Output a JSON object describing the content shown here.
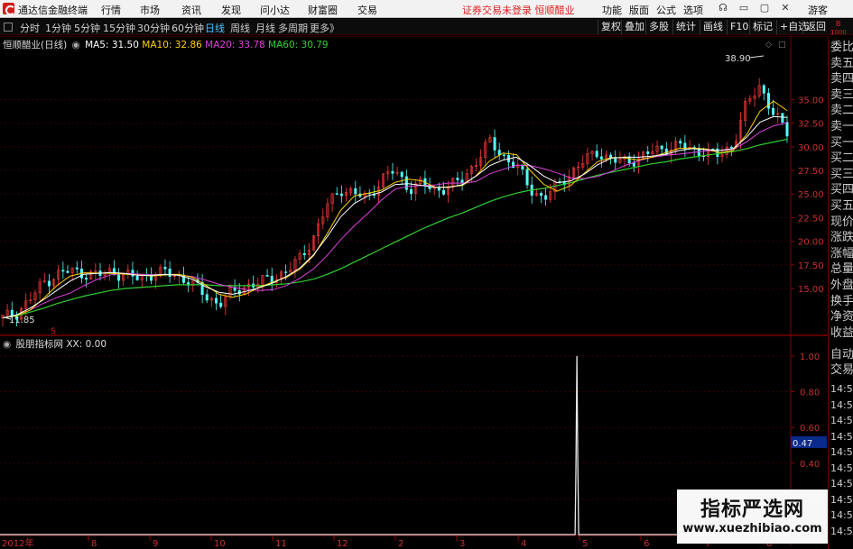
{
  "window": {
    "title": "通达信金融终端",
    "menus": [
      "行情",
      "市场",
      "资讯",
      "发现",
      "问小达",
      "财富圈",
      "交易"
    ],
    "notice": "证券交易未登录  恒顺醋业",
    "right_menus": [
      "功能",
      "版面",
      "公式",
      "选项"
    ],
    "user": "游客"
  },
  "toolbar": {
    "periods": [
      "分时",
      "1分钟",
      "5分钟",
      "15分钟",
      "30分钟",
      "60分钟",
      "日线",
      "周线",
      "月线",
      "多周期",
      "更多》"
    ],
    "active_period": "日线",
    "right_buttons": [
      "复权",
      "叠加",
      "多股",
      "统计",
      "画线",
      "F10",
      "标记",
      "+自选",
      "返回"
    ]
  },
  "stock": {
    "name_line": "恒顺醋业(日线)",
    "ma": [
      {
        "label": "MA5: 31.50",
        "color": "#ffffff"
      },
      {
        "label": "MA10: 32.86",
        "color": "#ffd200"
      },
      {
        "label": "MA20: 33.78",
        "color": "#e040e0"
      },
      {
        "label": "MA60: 30.79",
        "color": "#30d030"
      }
    ],
    "high_label": "38.90",
    "low_label": "11.85"
  },
  "indicator": {
    "title": "股朋指标网",
    "value": "XX: 0.00",
    "current": "0.47"
  },
  "side_panel": {
    "top_small": [
      "B",
      "1000"
    ],
    "labels": [
      "委比",
      "卖五",
      "卖四",
      "卖三",
      "卖二",
      "卖一",
      "买一",
      "买二",
      "买三",
      "买四",
      "买五",
      "现价",
      "涨跌",
      "涨幅",
      "总量",
      "外盘",
      "换手",
      "净资",
      "收益"
    ],
    "auto_trade": [
      "自动",
      "交易"
    ],
    "times": [
      "14:56",
      "14:56",
      "14:56",
      "14:56",
      "14:56",
      "14:56",
      "14:56",
      "14:56",
      "14:56",
      "14:56"
    ]
  },
  "watermark": {
    "name": "指标严选网",
    "url": "www.xuezhibiao.com"
  },
  "chart_data": [
    {
      "type": "candlestick",
      "title": "恒顺醋业(日线)",
      "y_ticks": [
        "35.00",
        "32.50",
        "30.00",
        "27.50",
        "25.00",
        "22.50",
        "20.00",
        "17.50",
        "15.00"
      ],
      "y_tick_values": [
        35,
        32.5,
        30,
        27.5,
        25,
        22.5,
        20,
        17.5,
        15
      ],
      "ylim": [
        11,
        40
      ],
      "x_ticks": [
        "2012年",
        "8",
        "9",
        "10",
        "11",
        "12",
        "2",
        "3",
        "4",
        "5",
        "6",
        "7",
        "8"
      ],
      "series": [
        {
          "name": "close",
          "values": [
            11.9,
            12.4,
            13.8,
            15.6,
            16.5,
            16.9,
            16.6,
            16.4,
            16.8,
            16.4,
            16.1,
            16.5,
            16.7,
            16.3,
            15.6,
            14.2,
            13.4,
            14.6,
            15.3,
            15.6,
            16.2,
            16.8,
            18.2,
            20.5,
            23.8,
            25.6,
            25.0,
            24.6,
            26.6,
            27.5,
            25.6,
            26.1,
            25.4,
            25.8,
            26.5,
            28.5,
            30.5,
            29.0,
            28.0,
            25.5,
            24.6,
            25.8,
            27.3,
            28.5,
            29.5,
            28.6,
            28.4,
            28.8,
            29.5,
            29.8,
            30.2,
            29.6,
            29.5,
            29.0,
            30.3,
            34.5,
            36.5,
            33.5,
            31.5
          ]
        },
        {
          "name": "MA5",
          "values": [
            11.9,
            12.2,
            12.9,
            13.8,
            14.8,
            15.8,
            16.5,
            16.6,
            16.7,
            16.6,
            16.4,
            16.4,
            16.5,
            16.4,
            16.0,
            15.2,
            14.6,
            14.4,
            14.7,
            15.1,
            15.6,
            16.3,
            17.2,
            18.6,
            20.5,
            22.6,
            24.0,
            24.8,
            25.2,
            26.0,
            26.1,
            25.9,
            25.7,
            25.7,
            26.0,
            26.9,
            28.0,
            28.6,
            28.9,
            28.0,
            26.9,
            26.2,
            26.4,
            27.1,
            28.1,
            28.8,
            28.9,
            28.9,
            29.0,
            29.2,
            29.6,
            29.8,
            29.7,
            29.6,
            29.8,
            31.0,
            32.6,
            33.2,
            33.1
          ]
        },
        {
          "name": "MA60",
          "values": [
            11.9,
            12.1,
            12.5,
            12.9,
            13.4,
            13.8,
            14.2,
            14.5,
            14.8,
            15.0,
            15.1,
            15.2,
            15.3,
            15.4,
            15.4,
            15.4,
            15.3,
            15.3,
            15.3,
            15.3,
            15.4,
            15.5,
            15.7,
            16.0,
            16.5,
            17.1,
            17.8,
            18.5,
            19.2,
            19.9,
            20.6,
            21.3,
            21.9,
            22.5,
            23.0,
            23.6,
            24.2,
            24.7,
            25.1,
            25.4,
            25.6,
            25.9,
            26.2,
            26.6,
            27.0,
            27.3,
            27.6,
            27.9,
            28.2,
            28.4,
            28.7,
            28.9,
            29.1,
            29.3,
            29.5,
            29.8,
            30.2,
            30.5,
            30.8
          ]
        }
      ]
    },
    {
      "type": "line",
      "title": "股朋指标网",
      "y_ticks": [
        "1.00",
        "0.80",
        "0.60",
        "0.40",
        "0.20"
      ],
      "y_tick_values": [
        1.0,
        0.8,
        0.6,
        0.4,
        0.2
      ],
      "ylim": [
        0,
        1.06
      ],
      "series": [
        {
          "name": "XX",
          "spike_fraction_of_span": 0.732,
          "spike_value": 1.0
        }
      ]
    }
  ]
}
